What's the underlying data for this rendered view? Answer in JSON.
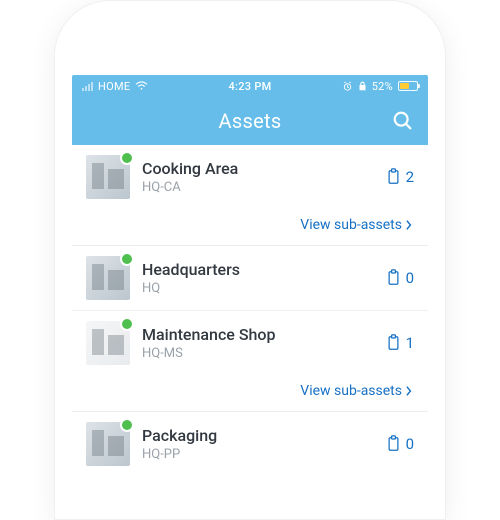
{
  "status_bar": {
    "carrier": "HOME",
    "time": "4:23 PM",
    "battery_percent": "52%"
  },
  "nav": {
    "title": "Assets"
  },
  "link_label": "View sub-assets",
  "assets": [
    {
      "name": "Cooking Area",
      "code": "HQ-CA",
      "count": "2",
      "thumb_variant": "default"
    },
    {
      "name": "Headquarters",
      "code": "HQ",
      "count": "0",
      "thumb_variant": "default"
    },
    {
      "name": "Maintenance Shop",
      "code": "HQ-MS",
      "count": "1",
      "thumb_variant": "light"
    },
    {
      "name": "Packaging",
      "code": "HQ-PP",
      "count": "0",
      "thumb_variant": "default"
    }
  ]
}
